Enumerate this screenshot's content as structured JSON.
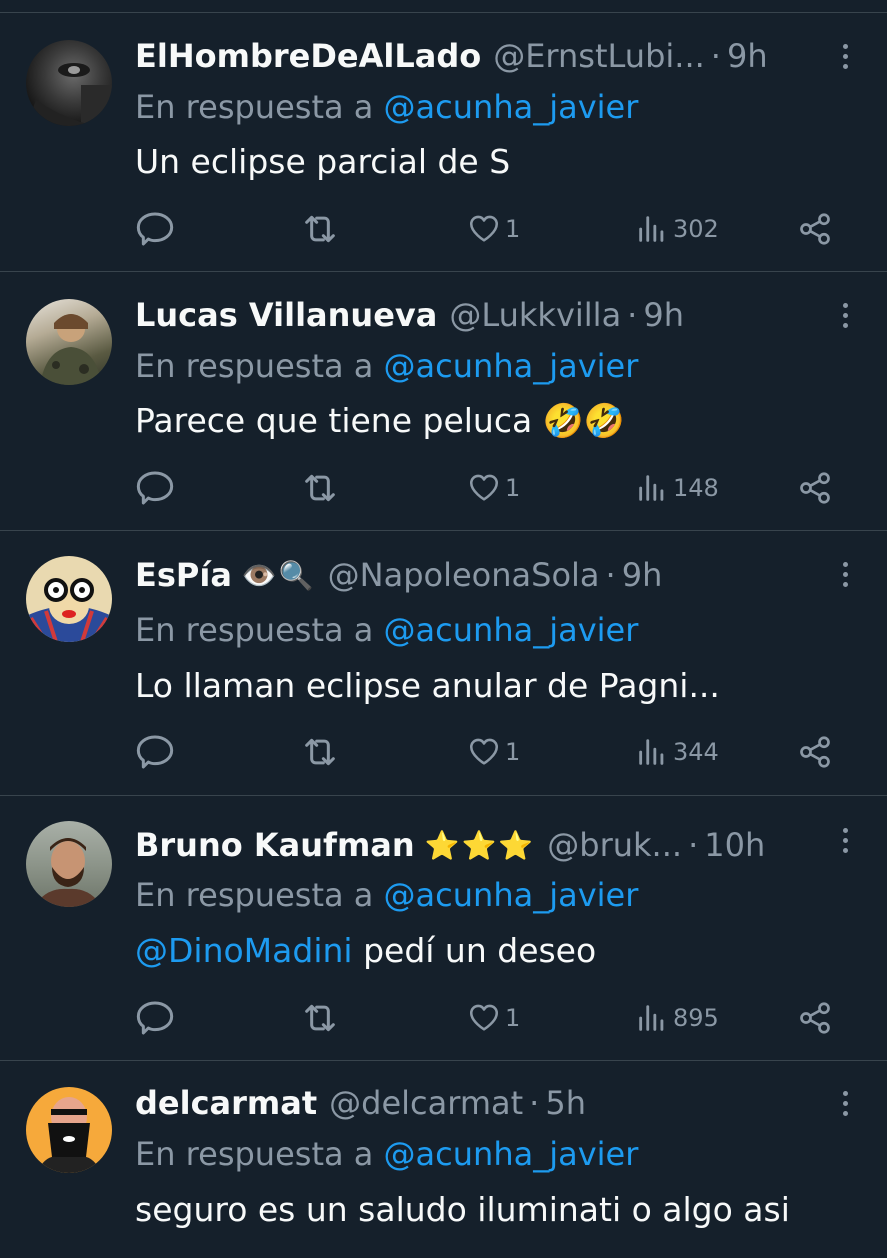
{
  "colors": {
    "background": "#15202b",
    "divider": "#38444d",
    "text_primary": "#f7f9f9",
    "text_secondary": "#8b98a5",
    "link": "#1d9bf0"
  },
  "tweets": [
    {
      "name": "ElHombreDeAlLado",
      "handle": "@ErnstLubi...",
      "time": "9h",
      "reply_prefix": "En respuesta a",
      "reply_to": "@acunha_javier",
      "text": "Un eclipse parcial de S",
      "likes": "1",
      "views": "302",
      "avatar_icon": "dark-portrait-avatar"
    },
    {
      "name": "Lucas Villanueva",
      "handle": "@Lukkvilla",
      "time": "9h",
      "reply_prefix": "En respuesta a",
      "reply_to": "@acunha_javier",
      "text": "Parece que tiene peluca 🤣🤣",
      "likes": "1",
      "views": "148",
      "avatar_icon": "soldier-avatar"
    },
    {
      "name": "EsPía",
      "badge": "👁️🔍",
      "handle": "@NapoleonaSola",
      "time": "9h",
      "reply_prefix": "En respuesta a",
      "reply_to": "@acunha_javier",
      "text": "Lo llaman eclipse anular de Pagni...",
      "likes": "1",
      "views": "344",
      "avatar_icon": "glasses-cartoon-avatar"
    },
    {
      "name": "Bruno Kaufman",
      "badge": "⭐⭐⭐",
      "handle": "@bruk...",
      "time": "10h",
      "reply_prefix": "En respuesta a",
      "reply_to": "@acunha_javier",
      "text_mention": "@DinoMadini",
      "text": " pedí un deseo",
      "likes": "1",
      "views": "895",
      "avatar_icon": "bearded-man-avatar"
    },
    {
      "name": "delcarmat",
      "handle": "@delcarmat",
      "time": "5h",
      "reply_prefix": "En respuesta a",
      "reply_to": "@acunha_javier",
      "text": "seguro es un saludo iluminati o algo asi",
      "avatar_icon": "bald-beard-cartoon-avatar"
    }
  ]
}
